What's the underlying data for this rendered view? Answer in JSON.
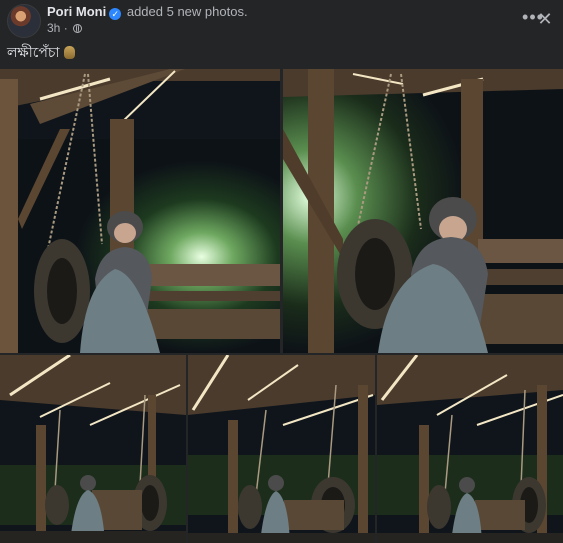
{
  "post": {
    "author": "Pori Moni",
    "action": "added 5 new photos.",
    "time": "3h",
    "verified_mark": "✓",
    "caption": "লক্ষীপেঁচা",
    "caption_icon": "owl-emoji",
    "more_glyph": "•••",
    "close_glyph": "✕"
  },
  "photos": [
    {
      "name": "photo-1",
      "icon": "swing-photo"
    },
    {
      "name": "photo-2",
      "icon": "swing-photo"
    },
    {
      "name": "photo-3",
      "icon": "swing-photo"
    },
    {
      "name": "photo-4",
      "icon": "swing-photo"
    },
    {
      "name": "photo-5",
      "icon": "swing-photo"
    }
  ],
  "colors": {
    "background": "#242526",
    "text_primary": "#e4e6eb",
    "text_secondary": "#b0b3b8",
    "verified": "#2d88ff"
  }
}
